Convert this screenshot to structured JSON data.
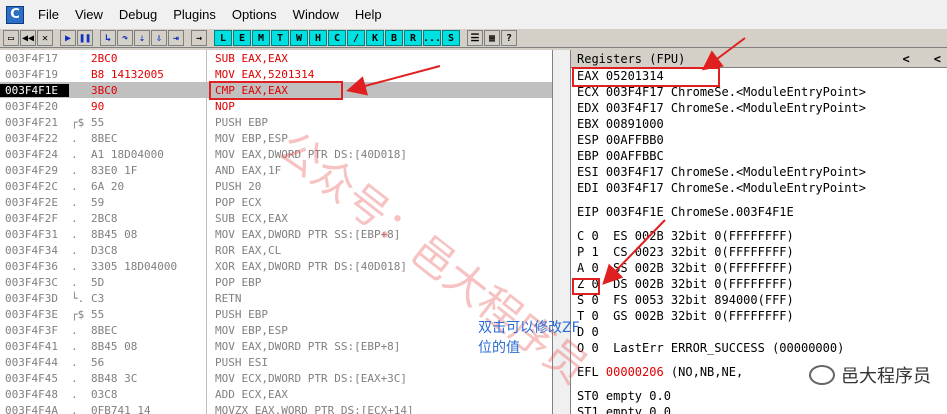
{
  "app": {
    "icon_letter": "C"
  },
  "menu": [
    "File",
    "View",
    "Debug",
    "Plugins",
    "Options",
    "Window",
    "Help"
  ],
  "toolbar": {
    "letters": [
      "L",
      "E",
      "M",
      "T",
      "W",
      "H",
      "C",
      "/",
      "K",
      "B",
      "R",
      "...",
      "S"
    ]
  },
  "disasm": {
    "rows": [
      {
        "addr": "003F4F17",
        "mark": "",
        "hex": "2BC0",
        "asm": "SUB EAX,EAX",
        "red": true
      },
      {
        "addr": "003F4F19",
        "mark": "",
        "hex": "B8 14132005",
        "asm": "MOV EAX,5201314",
        "red": true
      },
      {
        "addr": "003F4F1E",
        "mark": "",
        "hex": "3BC0",
        "asm": "CMP EAX,EAX",
        "red": true,
        "sel": true
      },
      {
        "addr": "003F4F20",
        "mark": "",
        "hex": "90",
        "asm": "NOP",
        "red": true
      },
      {
        "addr": "003F4F21",
        "mark": "┌$",
        "hex": "55",
        "asm": "PUSH EBP"
      },
      {
        "addr": "003F4F22",
        "mark": ".",
        "hex": "8BEC",
        "asm": "MOV EBP,ESP"
      },
      {
        "addr": "003F4F24",
        "mark": ".",
        "hex": "A1 18D04000",
        "asm": "MOV EAX,DWORD PTR DS:[40D018]"
      },
      {
        "addr": "003F4F29",
        "mark": ".",
        "hex": "83E0 1F",
        "asm": "AND EAX,1F"
      },
      {
        "addr": "003F4F2C",
        "mark": ".",
        "hex": "6A 20",
        "asm": "PUSH 20"
      },
      {
        "addr": "003F4F2E",
        "mark": ".",
        "hex": "59",
        "asm": "POP ECX"
      },
      {
        "addr": "003F4F2F",
        "mark": ".",
        "hex": "2BC8",
        "asm": "SUB ECX,EAX"
      },
      {
        "addr": "003F4F31",
        "mark": ".",
        "hex": "8B45 08",
        "asm": "MOV EAX,DWORD PTR SS:[EBP+8]"
      },
      {
        "addr": "003F4F34",
        "mark": ".",
        "hex": "D3C8",
        "asm": "ROR EAX,CL"
      },
      {
        "addr": "003F4F36",
        "mark": ".",
        "hex": "3305 18D04000",
        "asm": "XOR EAX,DWORD PTR DS:[40D018]"
      },
      {
        "addr": "003F4F3C",
        "mark": ".",
        "hex": "5D",
        "asm": "POP EBP"
      },
      {
        "addr": "003F4F3D",
        "mark": "└.",
        "hex": "C3",
        "asm": "RETN"
      },
      {
        "addr": "003F4F3E",
        "mark": "┌$",
        "hex": "55",
        "asm": "PUSH EBP"
      },
      {
        "addr": "003F4F3F",
        "mark": ".",
        "hex": "8BEC",
        "asm": "MOV EBP,ESP"
      },
      {
        "addr": "003F4F41",
        "mark": ".",
        "hex": "8B45 08",
        "asm": "MOV EAX,DWORD PTR SS:[EBP+8]"
      },
      {
        "addr": "003F4F44",
        "mark": ".",
        "hex": "56",
        "asm": "PUSH ESI"
      },
      {
        "addr": "003F4F45",
        "mark": ".",
        "hex": "8B48 3C",
        "asm": "MOV ECX,DWORD PTR DS:[EAX+3C]"
      },
      {
        "addr": "003F4F48",
        "mark": ".",
        "hex": "03C8",
        "asm": "ADD ECX,EAX"
      },
      {
        "addr": "003F4F4A",
        "mark": ".",
        "hex": "0FB741 14",
        "asm": "MOVZX EAX,WORD PTR DS:[ECX+14]"
      }
    ]
  },
  "registers": {
    "header": "Registers (FPU)",
    "nav_left": "<",
    "nav_right": "<",
    "lines": [
      {
        "text": "EAX 05201314"
      },
      {
        "text": "ECX 003F4F17 ChromeSe.<ModuleEntryPoint>"
      },
      {
        "text": "EDX 003F4F17 ChromeSe.<ModuleEntryPoint>"
      },
      {
        "text": "EBX 00891000"
      },
      {
        "text": "ESP 00AFFBB0"
      },
      {
        "text": "EBP 00AFFBBC"
      },
      {
        "text": "ESI 003F4F17 ChromeSe.<ModuleEntryPoint>"
      },
      {
        "text": "EDI 003F4F17 ChromeSe.<ModuleEntryPoint>"
      },
      {
        "gap": true
      },
      {
        "text": "EIP 003F4F1E ChromeSe.003F4F1E"
      },
      {
        "gap": true
      },
      {
        "text": "C 0  ES 002B 32bit 0(FFFFFFFF)"
      },
      {
        "text": "P 1  CS 0023 32bit 0(FFFFFFFF)"
      },
      {
        "text": "A 0  SS 002B 32bit 0(FFFFFFFF)"
      },
      {
        "text": "Z 0  DS 002B 32bit 0(FFFFFFFF)"
      },
      {
        "text": "S 0  FS 0053 32bit 894000(FFF)"
      },
      {
        "text": "T 0  GS 002B 32bit 0(FFFFFFFF)"
      },
      {
        "text": "D 0"
      },
      {
        "text": "O 0  LastErr ERROR_SUCCESS (00000000)"
      },
      {
        "gap": true
      },
      {
        "text": "EFL ",
        "red": "00000206",
        "rest": " (NO,NB,NE,"
      },
      {
        "gap": true
      },
      {
        "text": "ST0 empty 0.0"
      },
      {
        "text": "ST1 empty 0.0"
      }
    ]
  },
  "watermark": "公众号：邑大程序员",
  "note": "双击可以修改ZF位的值",
  "wechat_brand": "邑大程序员",
  "colors": {
    "accent_red": "#e02020",
    "note_blue": "#2a6dd6"
  }
}
